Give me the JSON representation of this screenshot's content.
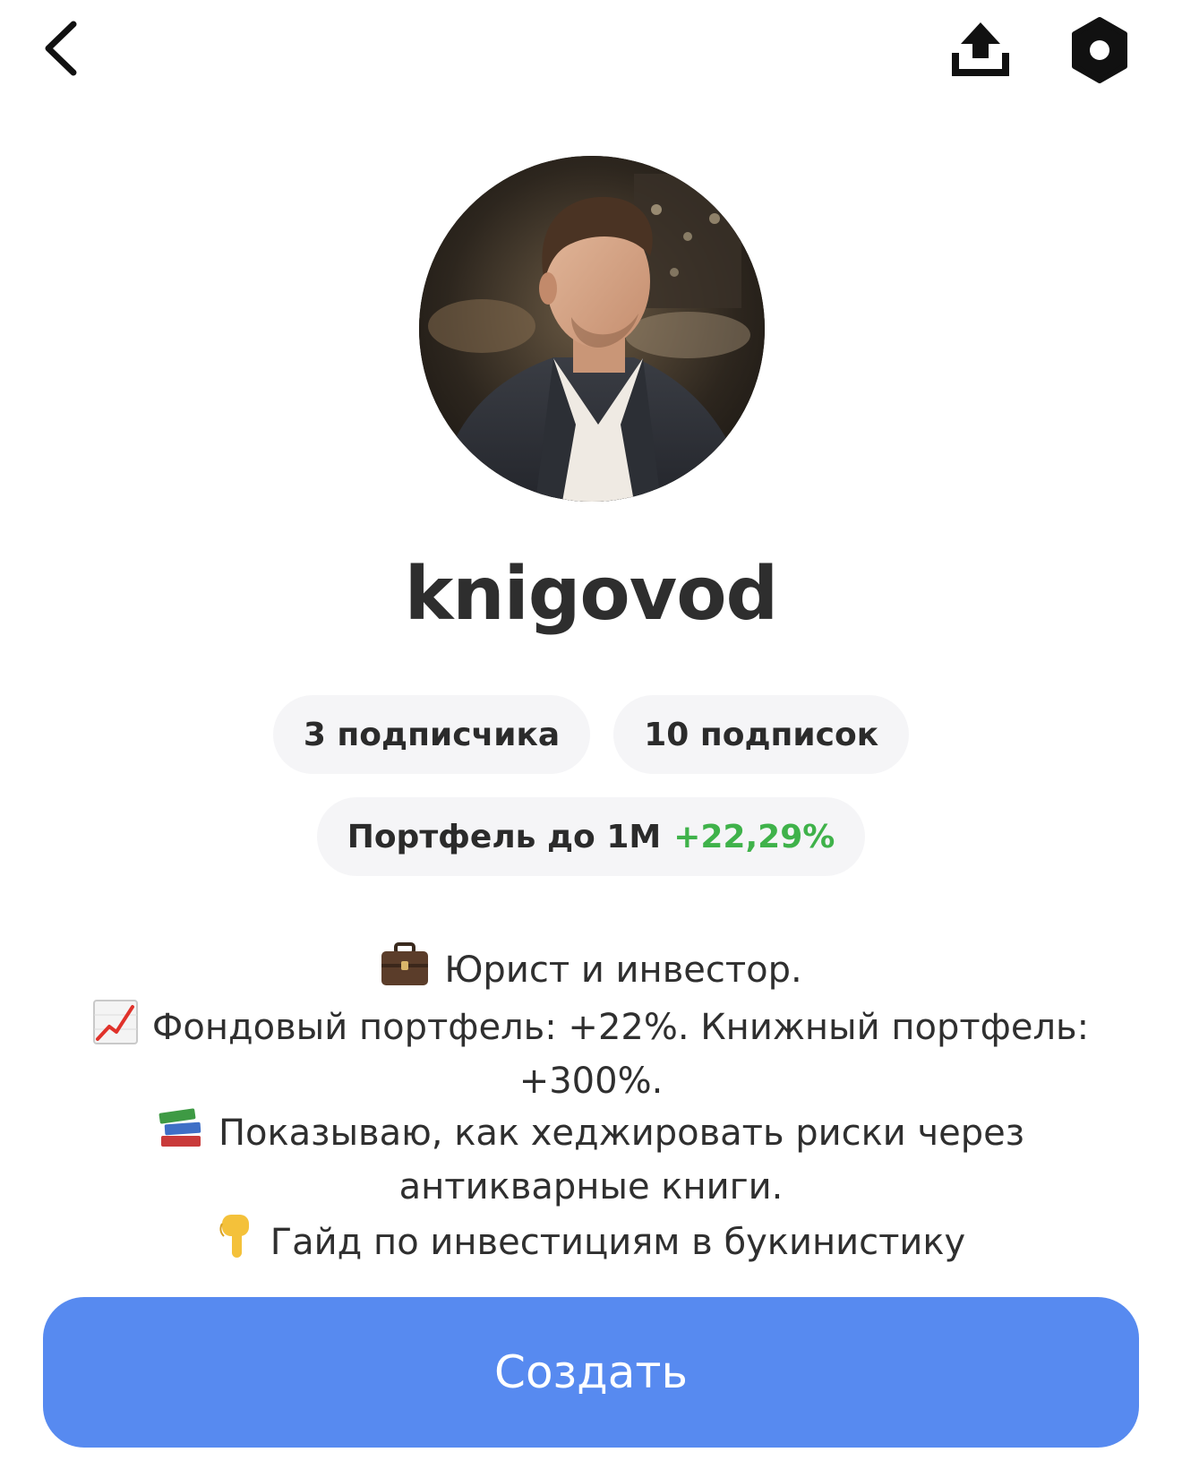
{
  "header": {
    "back_icon": "chevron-left-icon",
    "share_icon": "share-upload-icon",
    "settings_icon": "settings-hexagon-icon"
  },
  "profile": {
    "username": "knigovod",
    "stats": {
      "followers_label": "3 подписчика",
      "following_label": "10 подписок"
    },
    "portfolio": {
      "label": "Портфель до 1М",
      "return_value": "+22,29%",
      "return_color": "#3fb24a"
    },
    "bio": {
      "line1_icon": "briefcase-emoji",
      "line1": "Юрист и инвестор.",
      "line2_icon": "chart-increasing-emoji",
      "line2": "Фондовый портфель: +22%. Книжный портфель:",
      "line3": "+300%.",
      "line4_icon": "books-emoji",
      "line4": "Показываю, как хеджировать риски через",
      "line5": "антикварные книги.",
      "line6_icon": "pointing-down-emoji",
      "line6": "Гайд по инвестициям в букинистику"
    }
  },
  "actions": {
    "create_label": "Создать",
    "create_color": "#578af0"
  }
}
